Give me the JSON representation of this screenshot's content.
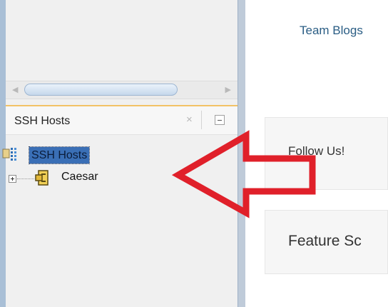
{
  "view": {
    "title": "SSH Hosts"
  },
  "tree": {
    "root_label": "SSH Hosts",
    "children": [
      {
        "label": "Caesar"
      }
    ]
  },
  "content": {
    "team_blogs": "Team Blogs",
    "follow_us": "Follow Us!",
    "feature": "Feature Sc"
  },
  "colors": {
    "annotation_arrow": "#e0202a",
    "selection": "#3a6fb6",
    "view_accent": "#f2c266"
  },
  "icons": [
    "chevron-left-icon",
    "chevron-right-icon",
    "close-icon",
    "minimize-icon",
    "ssh-hosts-root-icon",
    "expand-plus-icon",
    "host-node-icon",
    "annotation-arrow"
  ]
}
